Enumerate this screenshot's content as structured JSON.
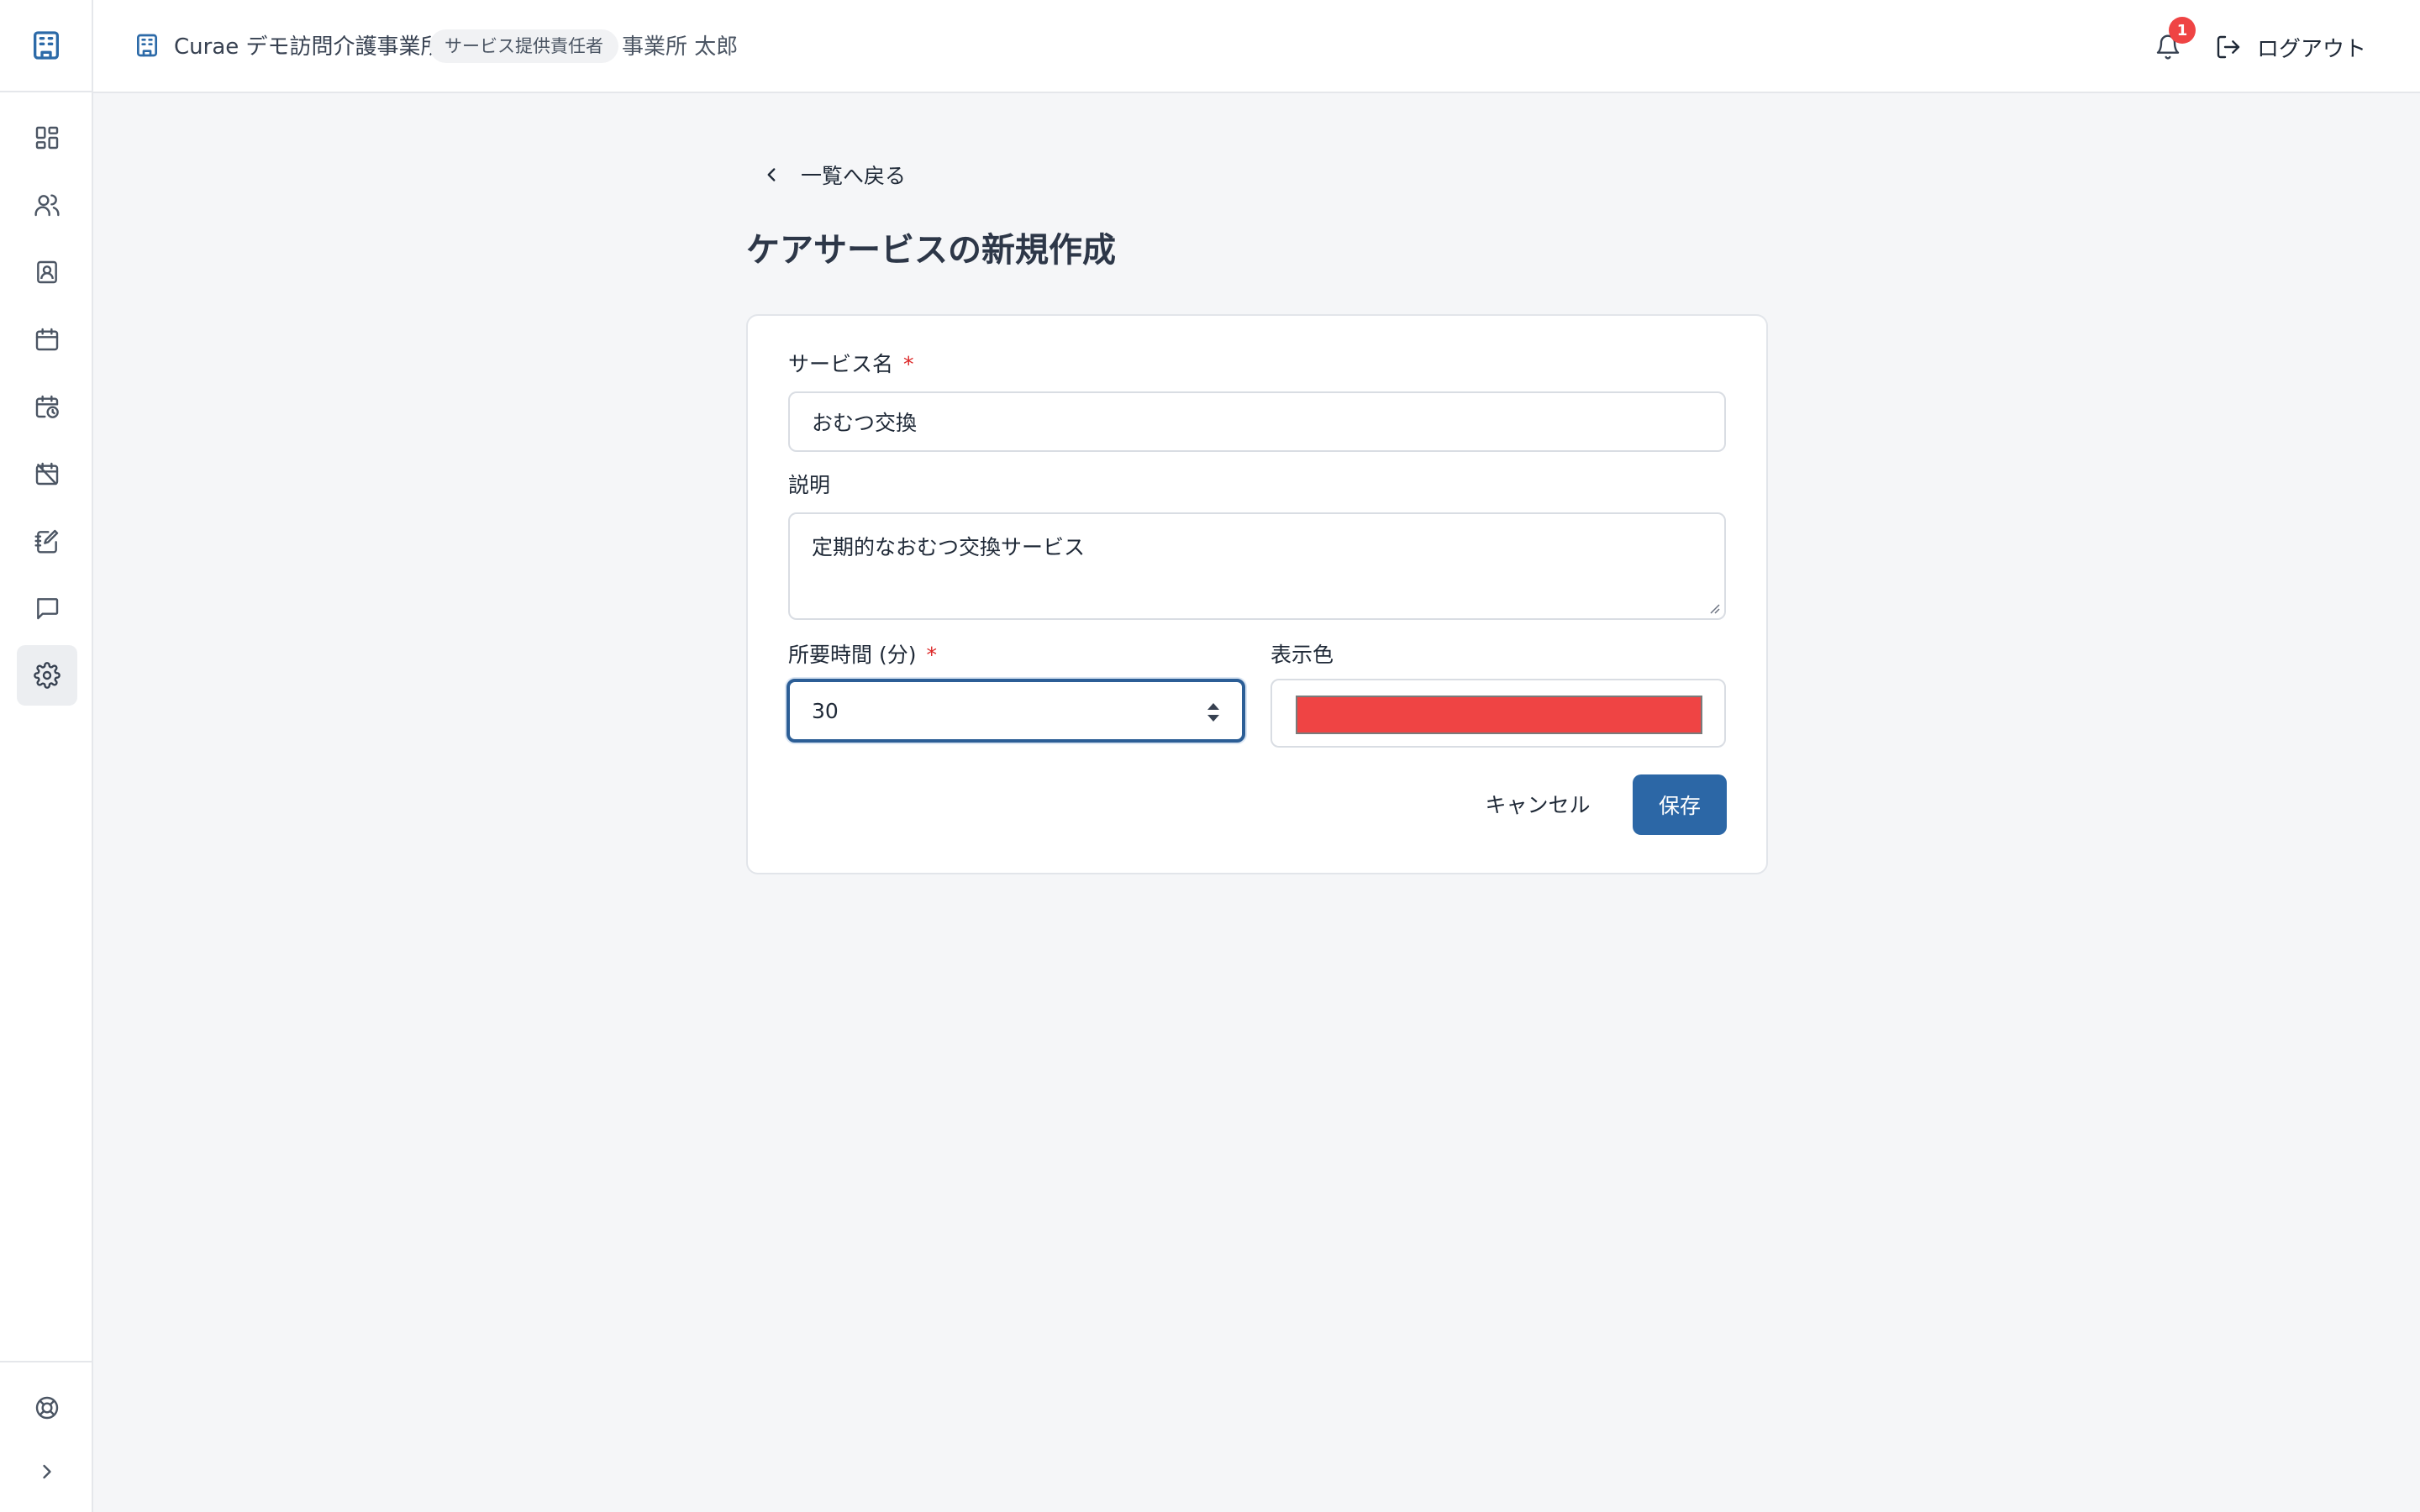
{
  "app": {
    "org_name": "Curae デモ訪問介護事業所",
    "role": "サービス提供責任者",
    "user_name": "事業所 太郎",
    "notification_count": "1",
    "logout_label": "ログアウト"
  },
  "sidebar": {
    "items": [
      {
        "icon": "dashboard-icon",
        "active": false
      },
      {
        "icon": "users-icon",
        "active": false
      },
      {
        "icon": "contact-card-icon",
        "active": false
      },
      {
        "icon": "calendar-icon",
        "active": false
      },
      {
        "icon": "calendar-clock-icon",
        "active": false
      },
      {
        "icon": "calendar-off-icon",
        "active": false
      },
      {
        "icon": "notebook-pen-icon",
        "active": false
      },
      {
        "icon": "message-icon",
        "active": false
      },
      {
        "icon": "settings-icon",
        "active": true
      }
    ],
    "bottom": [
      "help-lifebuoy-icon",
      "expand-chevron-icon"
    ]
  },
  "page": {
    "back_label": "一覧へ戻る",
    "title": "ケアサービスの新規作成"
  },
  "form": {
    "service_name_label": "サービス名",
    "service_name_value": "おむつ交換",
    "description_label": "説明",
    "description_value": "定期的なおむつ交換サービス",
    "duration_label": "所要時間 (分)",
    "duration_value": "30",
    "color_label": "表示色",
    "color_value": "#ef4444",
    "required_mark": "*",
    "cancel_label": "キャンセル",
    "save_label": "保存"
  },
  "colors": {
    "primary": "#2c67a6",
    "badge": "#ef4444",
    "required": "#dc2626"
  }
}
